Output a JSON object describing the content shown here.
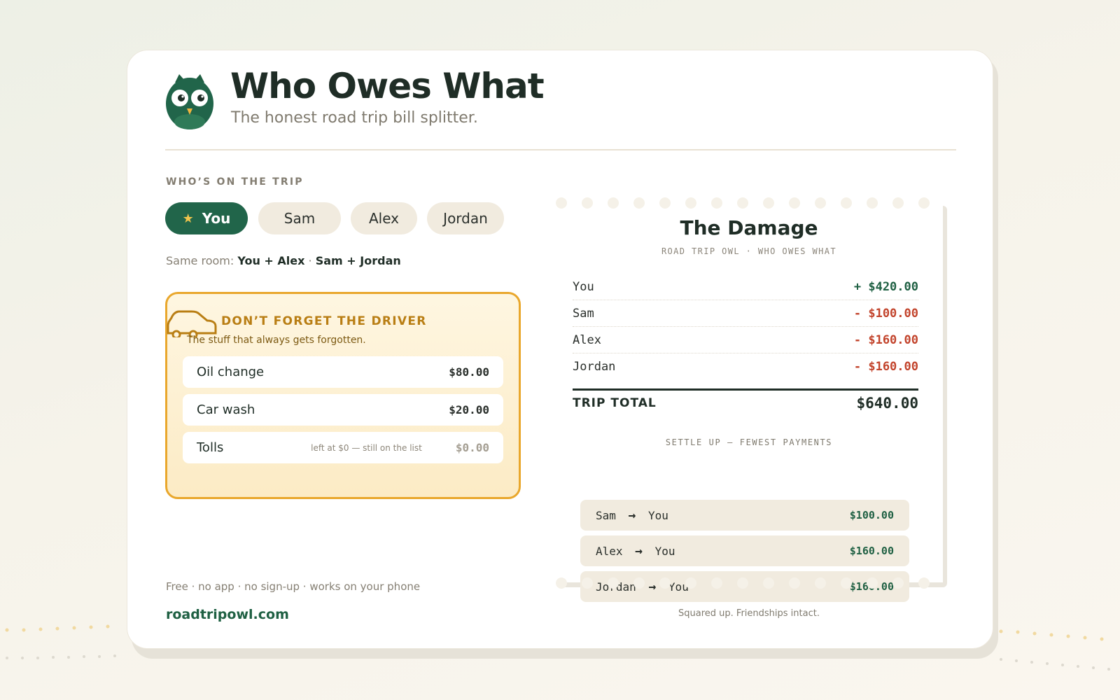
{
  "header": {
    "title": "Who Owes What",
    "subtitle": "The honest road trip bill splitter."
  },
  "trip": {
    "section_label": "WHO’S ON THE TRIP",
    "people": [
      "You",
      "Sam",
      "Alex",
      "Jordan"
    ],
    "active_person": "You",
    "room_label": "Same room:",
    "room_pairs": [
      "You + Alex",
      "Sam + Jordan"
    ],
    "room_separator": "·"
  },
  "driver": {
    "title": "DON’T FORGET THE DRIVER",
    "subtitle": "The stuff that always gets forgotten.",
    "items": [
      {
        "name": "Oil change",
        "note": "",
        "amount": "$80.00"
      },
      {
        "name": "Car wash",
        "note": "",
        "amount": "$20.00"
      },
      {
        "name": "Tolls",
        "note": "left at $0 — still on the list",
        "amount": "$0.00"
      }
    ]
  },
  "footer": {
    "note": "Free · no app · no sign-up · works on your phone",
    "link": "roadtripowl.com"
  },
  "receipt": {
    "title": "The Damage",
    "subtitle": "ROAD TRIP OWL · WHO OWES WHAT",
    "balances": [
      {
        "name": "You",
        "amount": "+ $420.00",
        "sign": "positive"
      },
      {
        "name": "Sam",
        "amount": "- $100.00",
        "sign": "negative"
      },
      {
        "name": "Alex",
        "amount": "- $160.00",
        "sign": "negative"
      },
      {
        "name": "Jordan",
        "amount": "- $160.00",
        "sign": "negative"
      }
    ],
    "total_label": "TRIP TOTAL",
    "total_amount": "$640.00",
    "settle_label": "SETTLE UP — FEWEST PAYMENTS",
    "payments": [
      {
        "from": "Sam",
        "to": "You",
        "amount": "$100.00"
      },
      {
        "from": "Alex",
        "to": "You",
        "amount": "$160.00"
      },
      {
        "from": "Jordan",
        "to": "You",
        "amount": "$160.00"
      }
    ],
    "closing": "Squared up. Friendships intact."
  },
  "colors": {
    "brand_green": "#21654a",
    "positive": "#1f6043",
    "negative": "#c2432b",
    "driver_accent": "#e9a72c",
    "chip_bg": "#f1ebdf"
  },
  "icons": {
    "logo": "owl-icon",
    "driver": "car-icon",
    "active_chip": "star-icon",
    "payment": "arrow-right-icon"
  }
}
